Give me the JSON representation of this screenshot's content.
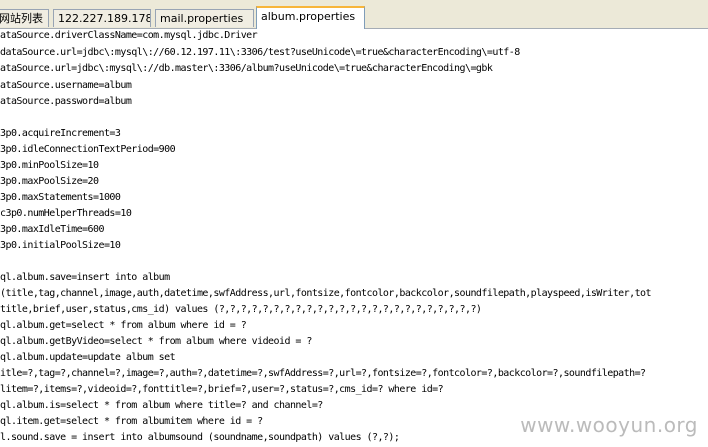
{
  "tabs": [
    {
      "label": "网站列表",
      "active": false
    },
    {
      "label": "122.227.189.178",
      "active": false
    },
    {
      "label": "mail.properties",
      "active": false
    },
    {
      "label": "album.properties",
      "active": true
    }
  ],
  "colors": {
    "active_tab_accent": "#f7b53a",
    "tab_bar_bg": "#ece9d8"
  },
  "editor": {
    "lines": [
      "ataSource.driverClassName=com.mysql.jdbc.Driver",
      "dataSource.url=jdbc\\:mysql\\://60.12.197.11\\:3306/test?useUnicode\\=true&characterEncoding\\=utf-8",
      "ataSource.url=jdbc\\:mysql\\://db.master\\:3306/album?useUnicode\\=true&characterEncoding\\=gbk",
      "ataSource.username=album",
      "ataSource.password=album",
      "",
      "3p0.acquireIncrement=3",
      "3p0.idleConnectionTextPeriod=900",
      "3p0.minPoolSize=10",
      "3p0.maxPoolSize=20",
      "3p0.maxStatements=1000",
      "c3p0.numHelperThreads=10",
      "3p0.maxIdleTime=600",
      "3p0.initialPoolSize=10",
      "",
      "ql.album.save=insert into album",
      "(title,tag,channel,image,auth,datetime,swfAddress,url,fontsize,fontcolor,backcolor,soundfilepath,playspeed,isWriter,tot",
      "title,brief,user,status,cms_id) values (?,?,?,?,?,?,?,?,?,?,?,?,?,?,?,?,?,?,?,?,?,?,?,?)",
      "ql.album.get=select * from album where id = ?",
      "ql.album.getByVideo=select * from album where videoid = ?",
      "ql.album.update=update album set",
      "itle=?,tag=?,channel=?,image=?,auth=?,datetime=?,swfAddress=?,url=?,fontsize=?,fontcolor=?,backcolor=?,soundfilepath=?",
      "litem=?,items=?,videoid=?,fonttitle=?,brief=?,user=?,status=?,cms_id=? where id=?",
      "ql.album.is=select * from album where title=? and channel=?",
      "ql.item.get=select * from albumitem where id = ?",
      "l.sound.save = insert into albumsound (soundname,soundpath) values (?,?);"
    ]
  },
  "watermark": "www.wooyun.org"
}
